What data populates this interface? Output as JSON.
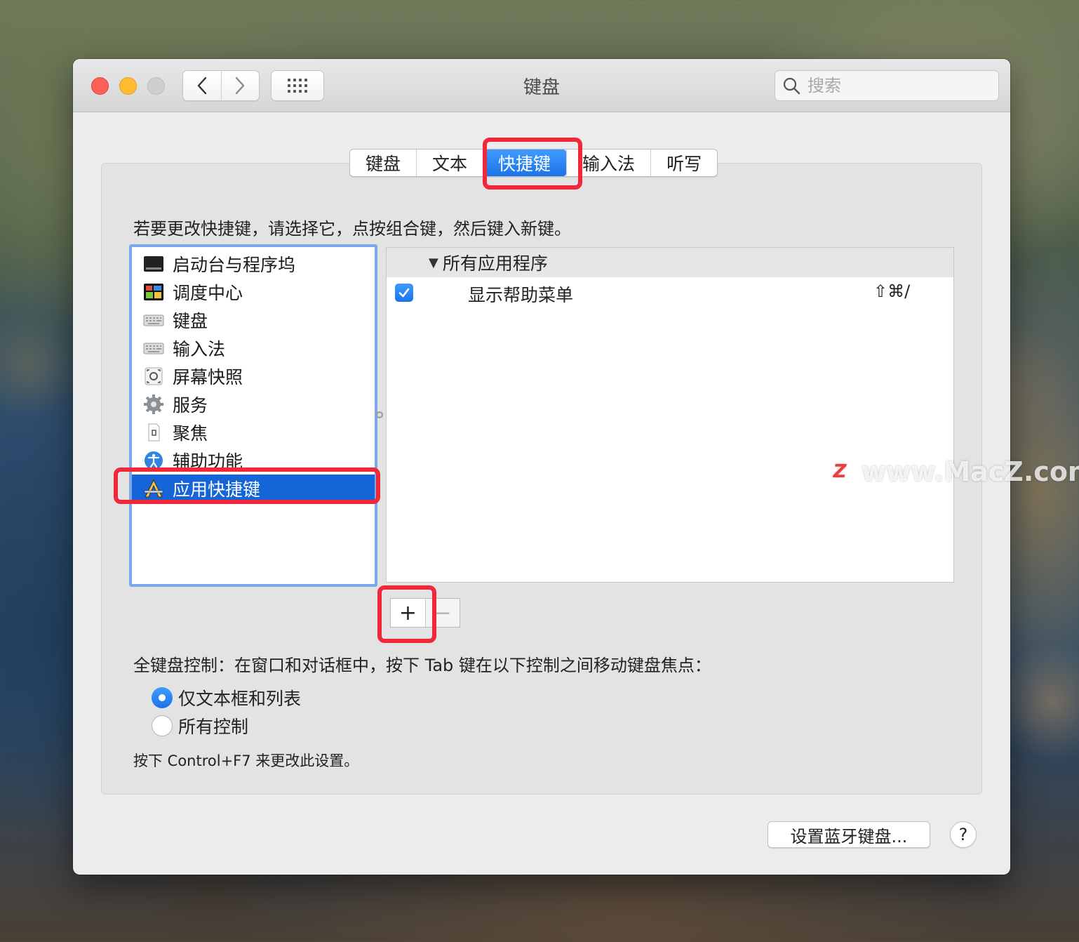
{
  "window": {
    "title": "键盘",
    "search_placeholder": "搜索"
  },
  "tabs": [
    {
      "label": "键盘",
      "active": false
    },
    {
      "label": "文本",
      "active": false
    },
    {
      "label": "快捷键",
      "active": true
    },
    {
      "label": "输入法",
      "active": false
    },
    {
      "label": "听写",
      "active": false
    }
  ],
  "instruction": "若要更改快捷键，请选择它，点按组合键，然后键入新键。",
  "categories": [
    {
      "label": "启动台与程序坞",
      "icon": "launchpad-dock-icon",
      "selected": false
    },
    {
      "label": "调度中心",
      "icon": "mission-control-icon",
      "selected": false
    },
    {
      "label": "键盘",
      "icon": "keyboard-icon",
      "selected": false
    },
    {
      "label": "输入法",
      "icon": "input-method-icon",
      "selected": false
    },
    {
      "label": "屏幕快照",
      "icon": "screenshot-icon",
      "selected": false
    },
    {
      "label": "服务",
      "icon": "gear-icon",
      "selected": false
    },
    {
      "label": "聚焦",
      "icon": "spotlight-icon",
      "selected": false
    },
    {
      "label": "辅助功能",
      "icon": "accessibility-icon",
      "selected": false
    },
    {
      "label": "应用快捷键",
      "icon": "app-shortcuts-icon",
      "selected": true
    }
  ],
  "shortcuts": {
    "group_label": "所有应用程序",
    "items": [
      {
        "checked": true,
        "label": "显示帮助菜单",
        "keys": "⇧⌘/"
      }
    ]
  },
  "buttons": {
    "add": "+",
    "remove": "−",
    "bluetooth_keyboard": "设置蓝牙键盘...",
    "help": "?"
  },
  "full_keyboard_access": {
    "label": "全键盘控制：在窗口和对话框中，按下 Tab 键在以下控制之间移动键盘焦点：",
    "options": [
      {
        "label": "仅文本框和列表",
        "selected": true
      },
      {
        "label": "所有控制",
        "selected": false
      }
    ],
    "hint": "按下 Control+F7 来更改此设置。"
  },
  "watermark": {
    "logo_letter": "Z",
    "text": "www.MacZ.com"
  },
  "colors": {
    "accent": "#1565d8",
    "highlight_box": "#f0283a"
  }
}
